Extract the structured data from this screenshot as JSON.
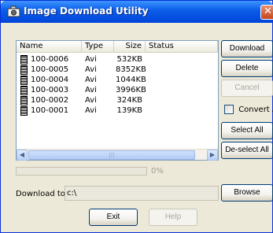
{
  "window": {
    "title": "Image Download Utility",
    "close_glyph": "✕"
  },
  "list": {
    "headers": {
      "name": "Name",
      "type": "Type",
      "size": "Size",
      "status": "Status"
    },
    "rows": [
      {
        "name": "100-0006",
        "type": "Avi",
        "size": "532KB",
        "status": ""
      },
      {
        "name": "100-0005",
        "type": "Avi",
        "size": "8352KB",
        "status": ""
      },
      {
        "name": "100-0004",
        "type": "Avi",
        "size": "1044KB",
        "status": ""
      },
      {
        "name": "100-0003",
        "type": "Avi",
        "size": "3996KB",
        "status": ""
      },
      {
        "name": "100-0002",
        "type": "Avi",
        "size": "324KB",
        "status": ""
      },
      {
        "name": "100-0001",
        "type": "Avi",
        "size": "139KB",
        "status": ""
      }
    ],
    "scroll_left_glyph": "◀",
    "scroll_right_glyph": "▶",
    "scroll_thumb_glyph": "|||"
  },
  "progress": {
    "percent": 0,
    "label": "0%"
  },
  "buttons": {
    "download": "Download",
    "delete": "Delete",
    "cancel": "Cancel",
    "select_all": "Select All",
    "deselect_all": "De-select All",
    "browse": "Browse",
    "exit": "Exit",
    "help": "Help"
  },
  "convert_avi": {
    "label": "Convert AVI",
    "checked": false
  },
  "download_to": {
    "label": "Download to",
    "value": "c:\\"
  },
  "icons": {
    "app": "camera-app-icon",
    "file": "film-file-icon"
  },
  "colors": {
    "titlebar": "#0a5be8",
    "window_bg": "#ece9d8",
    "close": "#c4451d"
  }
}
